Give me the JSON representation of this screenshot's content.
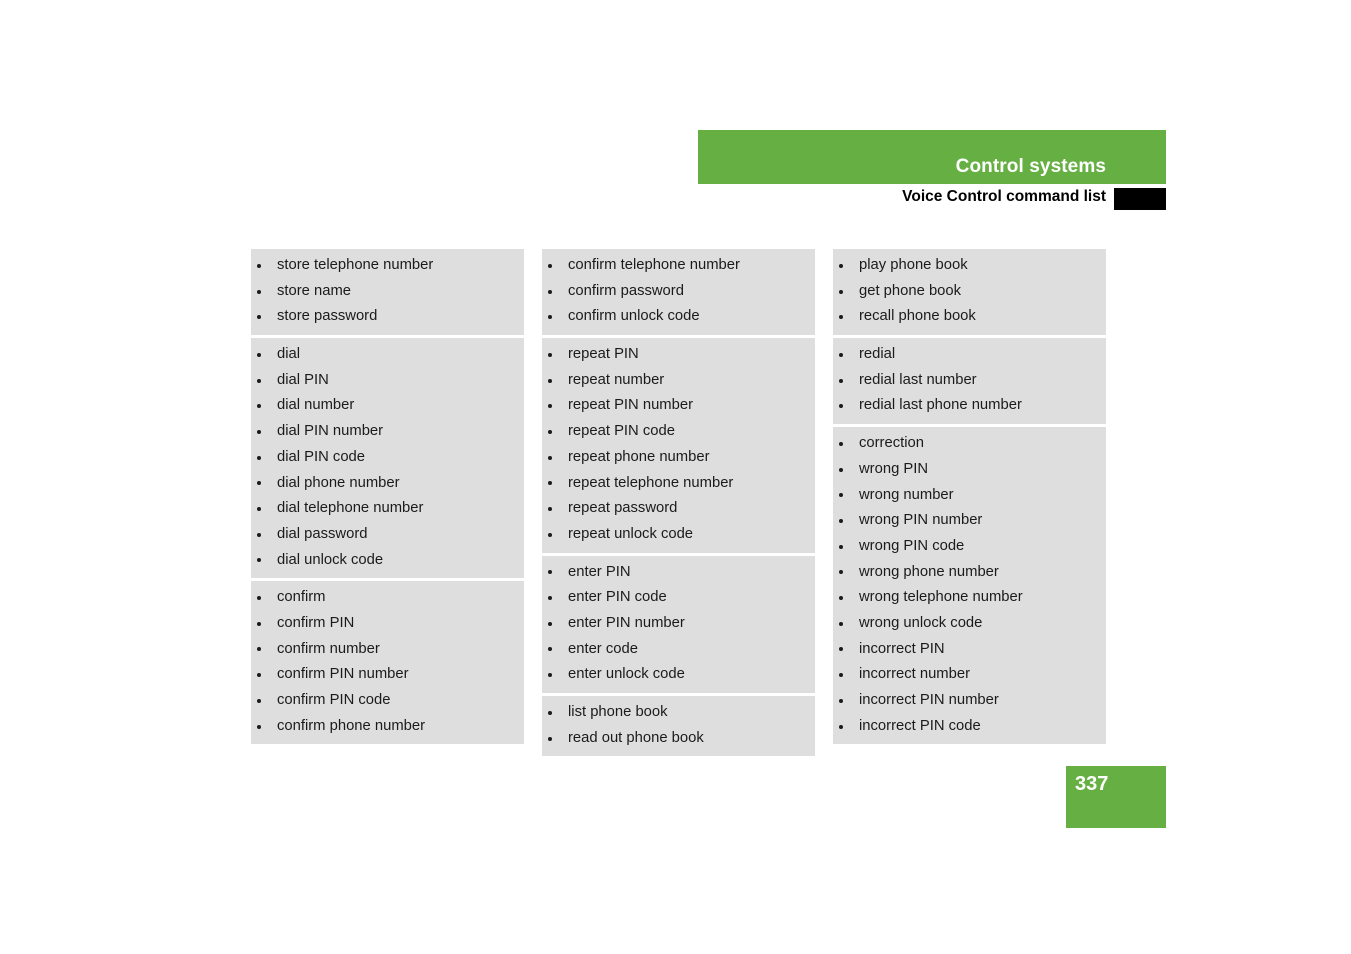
{
  "header": {
    "title": "Control systems",
    "subtitle": "Voice Control command list"
  },
  "footer": {
    "page_number": "337"
  },
  "colors": {
    "accent_green": "#66b043",
    "panel_gray": "#dedede",
    "tab_black": "#000000",
    "text": "#1b1b1b"
  },
  "columns": [
    {
      "groups": [
        {
          "items": [
            "store telephone number",
            "store name",
            "store password"
          ]
        },
        {
          "items": [
            "dial",
            "dial PIN",
            "dial number",
            "dial PIN number",
            "dial PIN code",
            "dial phone number",
            "dial telephone number",
            "dial password",
            "dial unlock code"
          ]
        },
        {
          "items": [
            "confirm",
            "confirm PIN",
            "confirm number",
            "confirm PIN number",
            "confirm PIN code",
            "confirm phone number"
          ]
        }
      ]
    },
    {
      "groups": [
        {
          "items": [
            "confirm telephone number",
            "confirm password",
            "confirm unlock code"
          ]
        },
        {
          "items": [
            "repeat PIN",
            "repeat number",
            "repeat PIN number",
            "repeat PIN code",
            "repeat phone number",
            "repeat telephone number",
            "repeat password",
            "repeat unlock code"
          ]
        },
        {
          "items": [
            "enter PIN",
            "enter PIN code",
            "enter PIN number",
            "enter code",
            "enter unlock code"
          ]
        },
        {
          "items": [
            "list phone book",
            "read out phone book"
          ]
        }
      ]
    },
    {
      "groups": [
        {
          "items": [
            "play phone book",
            "get phone book",
            "recall phone book"
          ]
        },
        {
          "items": [
            "redial",
            "redial last number",
            "redial last phone number"
          ]
        },
        {
          "items": [
            "correction",
            "wrong PIN",
            "wrong number",
            "wrong PIN number",
            "wrong PIN code",
            "wrong phone number",
            "wrong telephone number",
            "wrong unlock code",
            "incorrect PIN",
            "incorrect number",
            "incorrect PIN number",
            "incorrect PIN code"
          ]
        }
      ]
    }
  ]
}
